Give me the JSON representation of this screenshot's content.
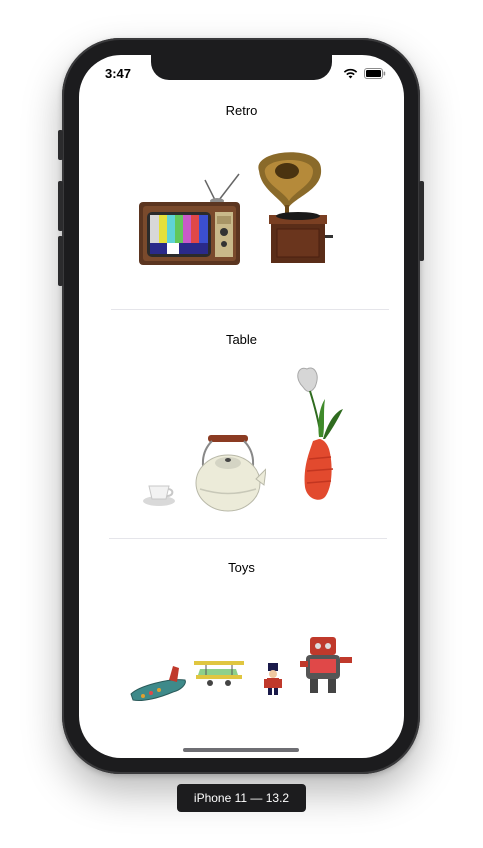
{
  "status_bar": {
    "time": "3:47"
  },
  "sections": [
    {
      "title": "Retro",
      "items": [
        "tv-icon",
        "gramophone-icon"
      ]
    },
    {
      "title": "Table",
      "items": [
        "teacup-icon",
        "kettle-icon",
        "tulip-vase-icon"
      ]
    },
    {
      "title": "Toys",
      "items": [
        "toy-plane-icon",
        "biplane-icon",
        "toy-soldier-icon",
        "toy-robot-icon"
      ]
    }
  ],
  "device_label": "iPhone 11 — 13.2"
}
